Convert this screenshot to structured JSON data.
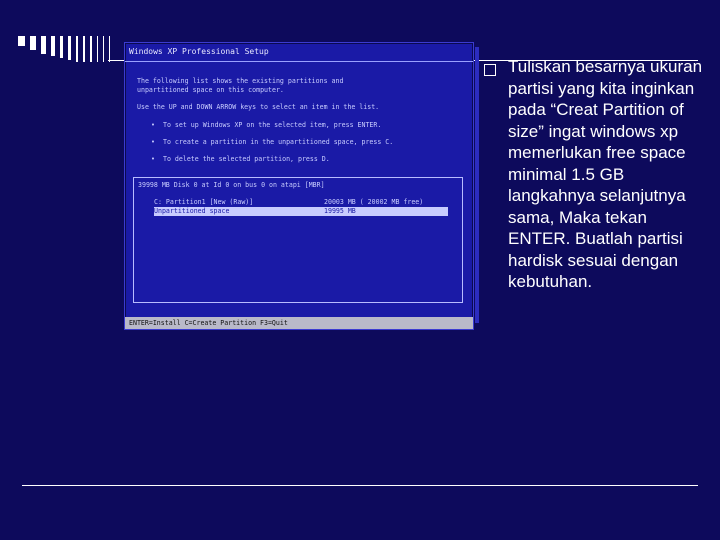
{
  "setup": {
    "title": "Windows XP Professional Setup",
    "intro": [
      "The following list shows the existing partitions and",
      "unpartitioned space on this computer."
    ],
    "instruction": "Use the UP and DOWN ARROW keys to select an item in the list.",
    "options": [
      "To set up Windows XP on the selected item, press ENTER.",
      "To create a partition in the unpartitioned space, press C.",
      "To delete the selected partition, press D."
    ],
    "disk_header": "39998 MB Disk 0 at Id 0 on bus 0 on atapi [MBR]",
    "partitions": [
      {
        "label": "C:  Partition1 [New (Raw)]",
        "size": "20003 MB ( 20002 MB free)",
        "selected": false
      },
      {
        "label": "    Unpartitioned space",
        "size": "19995 MB",
        "selected": true
      }
    ],
    "status_bar": "ENTER=Install   C=Create Partition   F3=Quit"
  },
  "description": "Tuliskan besarnya ukuran partisi yang kita inginkan pada “Creat Partition of size” ingat windows xp memerlukan free space minimal 1.5 GB langkahnya selanjutnya sama, Maka tekan ENTER. Buatlah partisi hardisk sesuai dengan kebutuhan.",
  "colors": {
    "background": "#0d0a5c",
    "setup_blue": "#1a1aa6",
    "text": "#ffffff"
  }
}
